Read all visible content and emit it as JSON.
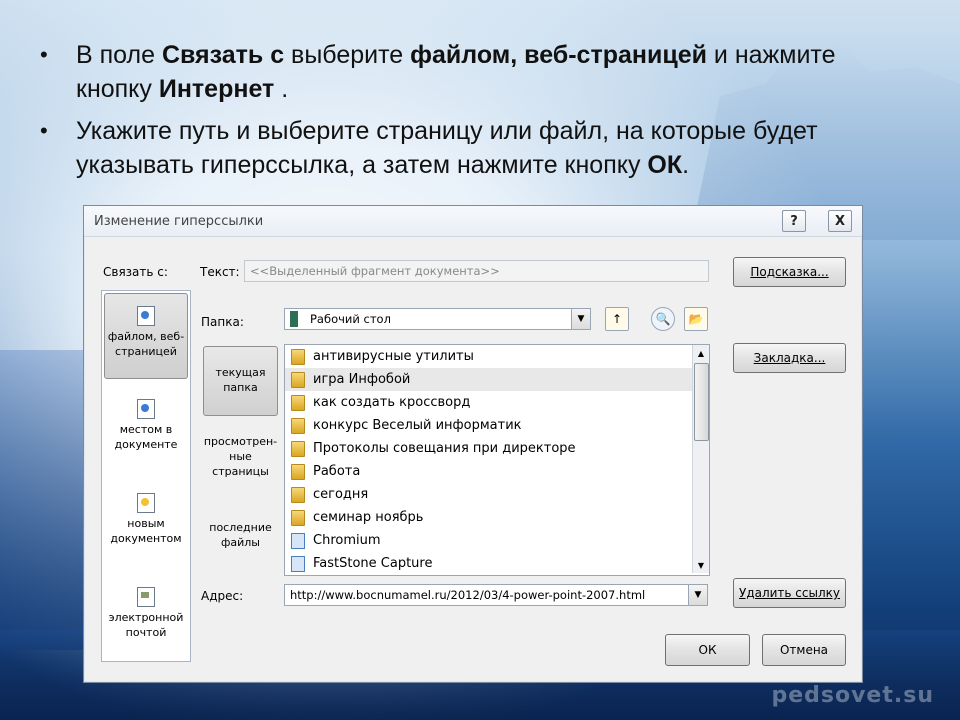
{
  "slide": {
    "bullet1": {
      "p1": "В поле ",
      "b1": "Связать с",
      "p2": " выберите ",
      "b2": "файлом, веб-страницей",
      "p3": " и нажмите кнопку ",
      "b3": "Интернет",
      "p4": " ."
    },
    "bullet2": {
      "p1": "Укажите путь и выберите страницу или файл, на которые будет указывать гиперссылка, а затем нажмите кнопку ",
      "b1": "ОК",
      "p2": "."
    },
    "bullet_glyph": "•",
    "watermark": "pedsovet.su"
  },
  "dialog": {
    "title": "Изменение гиперссылки",
    "help_label": "?",
    "close_label": "X",
    "link_to_label": "Связать с:",
    "text_label": "Текст:",
    "text_value": "<<Выделенный фрагмент документа>>",
    "tooltip_button": "Подсказка...",
    "folder_label": "Папка:",
    "folder_value": "Рабочий стол",
    "bookmark_button": "Закладка...",
    "address_label": "Адрес:",
    "address_value": "http://www.bocnumamel.ru/2012/03/4-power-point-2007.html",
    "remove_link_button": "Удалить ссылку",
    "ok_button": "ОК",
    "cancel_button": "Отмена",
    "link_options": [
      {
        "label": "файлом, веб-страницей",
        "icon": "web-page-icon"
      },
      {
        "label": "местом в документе",
        "icon": "place-in-document-icon"
      },
      {
        "label": "новым документом",
        "icon": "new-document-icon"
      },
      {
        "label": "электронной почтой",
        "icon": "email-icon"
      }
    ],
    "look_in": [
      {
        "label": "текущая папка"
      },
      {
        "label": "просмотрен-ные страницы"
      },
      {
        "label": "последние файлы"
      }
    ],
    "files": [
      {
        "name": "антивирусные утилиты",
        "type": "folder"
      },
      {
        "name": "игра Инфобой",
        "type": "folder"
      },
      {
        "name": "как создать кроссворд",
        "type": "folder"
      },
      {
        "name": "конкурс Веселый информатик",
        "type": "folder"
      },
      {
        "name": "Протоколы совещания при директоре",
        "type": "folder"
      },
      {
        "name": "Работа",
        "type": "folder"
      },
      {
        "name": "сегодня",
        "type": "folder"
      },
      {
        "name": "семинар ноябрь",
        "type": "folder"
      },
      {
        "name": "Chromium",
        "type": "shortcut"
      },
      {
        "name": "FastStone Capture",
        "type": "shortcut"
      }
    ],
    "toolbar_icons": [
      "up-folder-icon",
      "browse-web-icon",
      "browse-file-icon"
    ]
  }
}
